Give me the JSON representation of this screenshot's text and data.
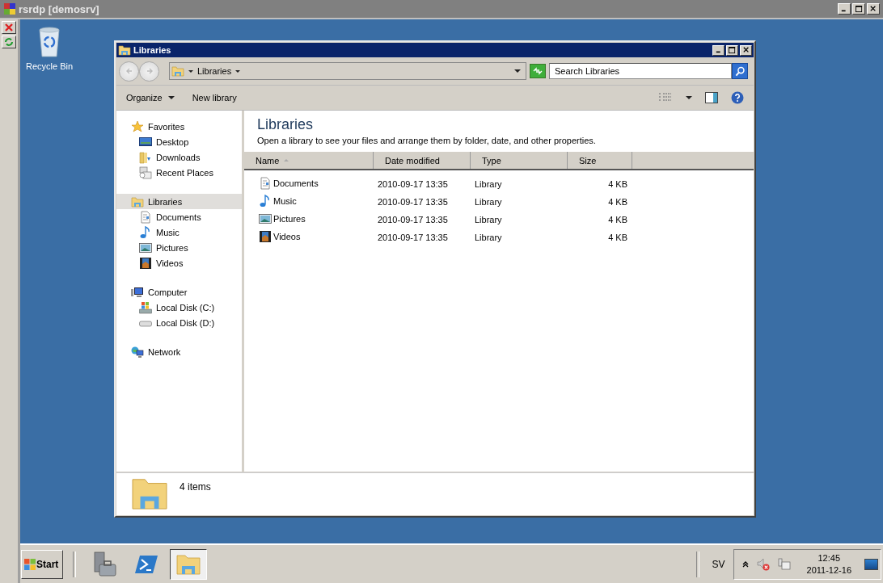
{
  "rdp_window": {
    "title": "rsrdp [demosrv]"
  },
  "desktop_icons": [
    {
      "label": "Recycle Bin"
    }
  ],
  "explorer": {
    "title": "Libraries",
    "breadcrumb": [
      "Libraries"
    ],
    "search": {
      "placeholder": "Search Libraries"
    },
    "toolbar": [
      {
        "label": "Organize",
        "dropdown": true
      },
      {
        "label": "New library",
        "dropdown": false
      }
    ],
    "nav": [
      {
        "label": "Favorites",
        "selected": false,
        "children": [
          {
            "label": "Desktop",
            "selected": false
          },
          {
            "label": "Downloads",
            "selected": false
          },
          {
            "label": "Recent Places",
            "selected": false
          }
        ]
      },
      {
        "label": "Libraries",
        "selected": true,
        "children": [
          {
            "label": "Documents",
            "selected": false
          },
          {
            "label": "Music",
            "selected": false
          },
          {
            "label": "Pictures",
            "selected": false
          },
          {
            "label": "Videos",
            "selected": false
          }
        ]
      },
      {
        "label": "Computer",
        "selected": false,
        "children": [
          {
            "label": "Local Disk (C:)",
            "selected": false
          },
          {
            "label": "Local Disk (D:)",
            "selected": false
          }
        ]
      },
      {
        "label": "Network",
        "selected": false
      }
    ],
    "heading": "Libraries",
    "description": "Open a library to see your files and arrange them by folder, date, and other properties.",
    "columns": [
      {
        "label": "Name",
        "sorted": true
      },
      {
        "label": "Date modified",
        "sorted": false
      },
      {
        "label": "Type",
        "sorted": false
      },
      {
        "label": "Size",
        "sorted": false
      }
    ],
    "rows": [
      {
        "name": "Documents",
        "date": "2010-09-17 13:35",
        "type": "Library",
        "size": "4 KB"
      },
      {
        "name": "Music",
        "date": "2010-09-17 13:35",
        "type": "Library",
        "size": "4 KB"
      },
      {
        "name": "Pictures",
        "date": "2010-09-17 13:35",
        "type": "Library",
        "size": "4 KB"
      },
      {
        "name": "Videos",
        "date": "2010-09-17 13:35",
        "type": "Library",
        "size": "4 KB"
      }
    ],
    "status": "4 items"
  },
  "taskbar": {
    "start": "Start",
    "apps": [
      {
        "selected": false
      },
      {
        "selected": false
      },
      {
        "selected": true
      }
    ],
    "language": "SV",
    "time": "12:45",
    "date": "2011-12-16"
  }
}
